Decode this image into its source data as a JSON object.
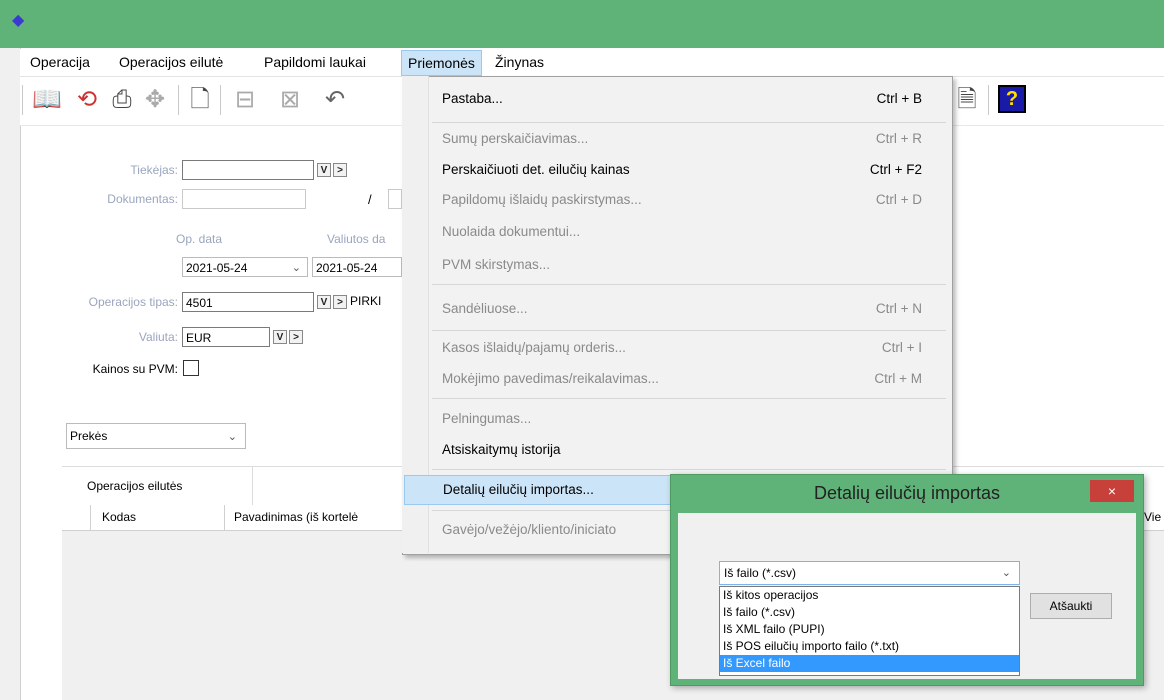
{
  "menubar": {
    "items": [
      "Operacija",
      "Operacijos eilutė",
      "Papildomi laukai",
      "Priemonės",
      "Žinynas"
    ],
    "open": "Priemonės"
  },
  "form": {
    "tiekejas_label": "Tiekėjas:",
    "dokumentas_label": "Dokumentas:",
    "doc_slash": "/",
    "op_data_label": "Op. data",
    "valiutos_data_label": "Valiutos da",
    "op_data_value": "2021-05-24",
    "valiutos_data_value": "2021-05-24",
    "operacijos_tipas_label": "Operacijos tipas:",
    "operacijos_tipas_value": "4501",
    "operacijos_tipas_desc": "PIRKI",
    "valiuta_label": "Valiuta:",
    "valiuta_value": "EUR",
    "kainos_su_pvm_label": "Kainos su PVM:",
    "prekes_value": "Prekės"
  },
  "grid": {
    "tab_label": "Operacijos eilutės",
    "columns": [
      "Kodas",
      "Pavadinimas (iš kortelė",
      "Vie"
    ]
  },
  "dropdown_menu": {
    "items": [
      {
        "label": "Pastaba...",
        "shortcut": "Ctrl + B",
        "disabled": false
      },
      {
        "label": "Sumų perskaičiavimas...",
        "shortcut": "Ctrl + R",
        "disabled": true
      },
      {
        "label": "Perskaičiuoti det. eilučių kainas",
        "shortcut": "Ctrl + F2",
        "disabled": false
      },
      {
        "label": "Papildomų išlaidų paskirstymas...",
        "shortcut": "Ctrl + D",
        "disabled": true
      },
      {
        "label": "Nuolaida dokumentui...",
        "shortcut": "",
        "disabled": true
      },
      {
        "label": "PVM skirstymas...",
        "shortcut": "",
        "disabled": true
      },
      {
        "label": "Sandėliuose...",
        "shortcut": "Ctrl + N",
        "disabled": true
      },
      {
        "label": "Kasos išlaidų/pajamų orderis...",
        "shortcut": "Ctrl + I",
        "disabled": true
      },
      {
        "label": "Mokėjimo pavedimas/reikalavimas...",
        "shortcut": "Ctrl + M",
        "disabled": true
      },
      {
        "label": "Pelningumas...",
        "shortcut": "",
        "disabled": true
      },
      {
        "label": "Atsiskaitymų istorija",
        "shortcut": "",
        "disabled": false
      },
      {
        "label": "Detalių eilučių importas...",
        "shortcut": "",
        "disabled": false,
        "highlighted": true
      },
      {
        "label": "Gavėjo/vežėjo/kliento/iniciato",
        "shortcut": "",
        "disabled": true
      }
    ]
  },
  "dialog": {
    "title": "Detalių eilučių importas",
    "close": "×",
    "selected": "Iš failo (*.csv)",
    "options": [
      "Iš kitos operacijos",
      "Iš failo (*.csv)",
      "Iš XML failo (PUPI)",
      "Iš POS eilučių importo failo (*.txt)",
      "Iš Excel failo"
    ],
    "highlighted_option": "Iš Excel failo",
    "cancel_label": "Atšaukti"
  },
  "colors": {
    "title_bar": "#5fb378",
    "menu_highlight": "#cce4f7",
    "option_selected": "#3399ff",
    "close_button": "#c8403a"
  }
}
